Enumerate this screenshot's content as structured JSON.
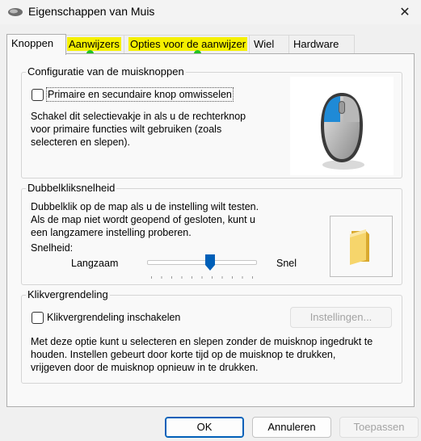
{
  "window": {
    "title": "Eigenschappen van Muis",
    "close_glyph": "✕"
  },
  "tabs": [
    {
      "label": "Knoppen",
      "active": true
    },
    {
      "label": "Aanwijzers",
      "highlighted": true
    },
    {
      "label": "Opties voor de aanwijzer",
      "highlighted": true
    },
    {
      "label": "Wiel"
    },
    {
      "label": "Hardware"
    }
  ],
  "buttons_config": {
    "title": "Configuratie van de muisknoppen",
    "swap_checkbox_label": "Primaire en secundaire knop omwisselen",
    "swap_checked": false,
    "description_lines": [
      "Schakel dit selectievakje in als u de rechterknop",
      "voor primaire functies wilt gebruiken (zoals",
      "selecteren en slepen)."
    ]
  },
  "double_click": {
    "title": "Dubbelkliksnelheid",
    "description_lines": [
      "Dubbelklik op de map als u de instelling wilt testen.",
      "Als de map niet wordt geopend of gesloten, kunt u",
      "een langzamere instelling proberen."
    ],
    "speed_label": "Snelheid:",
    "slow_label": "Langzaam",
    "fast_label": "Snel",
    "speed_fraction": 0.58
  },
  "click_lock": {
    "title": "Klikvergrendeling",
    "checkbox_label": "Klikvergrendeling inschakelen",
    "checked": false,
    "settings_button": "Instellingen...",
    "description_lines": [
      "Met deze optie kunt u selecteren en slepen zonder de muisknop ingedrukt te",
      "houden. Instellen gebeurt door korte tijd op de muisknop te drukken,",
      "vrijgeven door de muisknop opnieuw in te drukken."
    ]
  },
  "footer": {
    "ok": "OK",
    "cancel": "Annuleren",
    "apply": "Toepassen"
  },
  "colors": {
    "highlight": "#f5f000",
    "dot": "#22c322",
    "accent": "#005fb8",
    "mouse_button": "#1f8ad6"
  }
}
